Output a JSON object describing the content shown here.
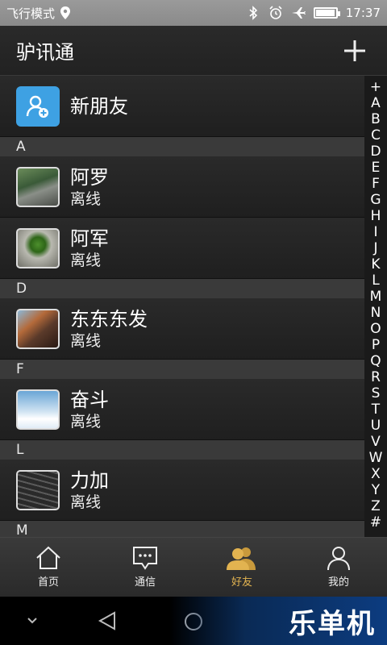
{
  "status_bar": {
    "mode": "飞行模式",
    "time": "17:37",
    "icons": [
      "location-icon",
      "bluetooth-icon",
      "alarm-icon",
      "airplane-icon",
      "battery-icon"
    ],
    "battery_level": 0.9
  },
  "header": {
    "title": "驴讯通",
    "add_icon": "plus-icon"
  },
  "new_friend": {
    "label": "新朋友",
    "icon": "add-contact-icon"
  },
  "sections": [
    {
      "letter": "A",
      "contacts": [
        {
          "name": "阿罗",
          "status": "离线"
        },
        {
          "name": "阿军",
          "status": "离线"
        }
      ]
    },
    {
      "letter": "D",
      "contacts": [
        {
          "name": "东东东发",
          "status": "离线"
        }
      ]
    },
    {
      "letter": "F",
      "contacts": [
        {
          "name": "奋斗",
          "status": "离线"
        }
      ]
    },
    {
      "letter": "L",
      "contacts": [
        {
          "name": "力加",
          "status": "离线"
        }
      ]
    },
    {
      "letter": "M",
      "contacts": []
    }
  ],
  "alphabet_index": [
    "+",
    "A",
    "B",
    "C",
    "D",
    "E",
    "F",
    "G",
    "H",
    "I",
    "J",
    "K",
    "L",
    "M",
    "N",
    "O",
    "P",
    "Q",
    "R",
    "S",
    "T",
    "U",
    "V",
    "W",
    "X",
    "Y",
    "Z",
    "#"
  ],
  "tabs": [
    {
      "label": "首页",
      "icon": "home-icon",
      "active": false
    },
    {
      "label": "通信",
      "icon": "chat-icon",
      "active": false
    },
    {
      "label": "好友",
      "icon": "friends-icon",
      "active": true
    },
    {
      "label": "我的",
      "icon": "profile-icon",
      "active": false
    }
  ],
  "colors": {
    "accent": "#e2b350",
    "new_friend_icon_bg": "#3ea1e3",
    "watermark_bg": "#0c3c80"
  },
  "watermark": "乐单机"
}
